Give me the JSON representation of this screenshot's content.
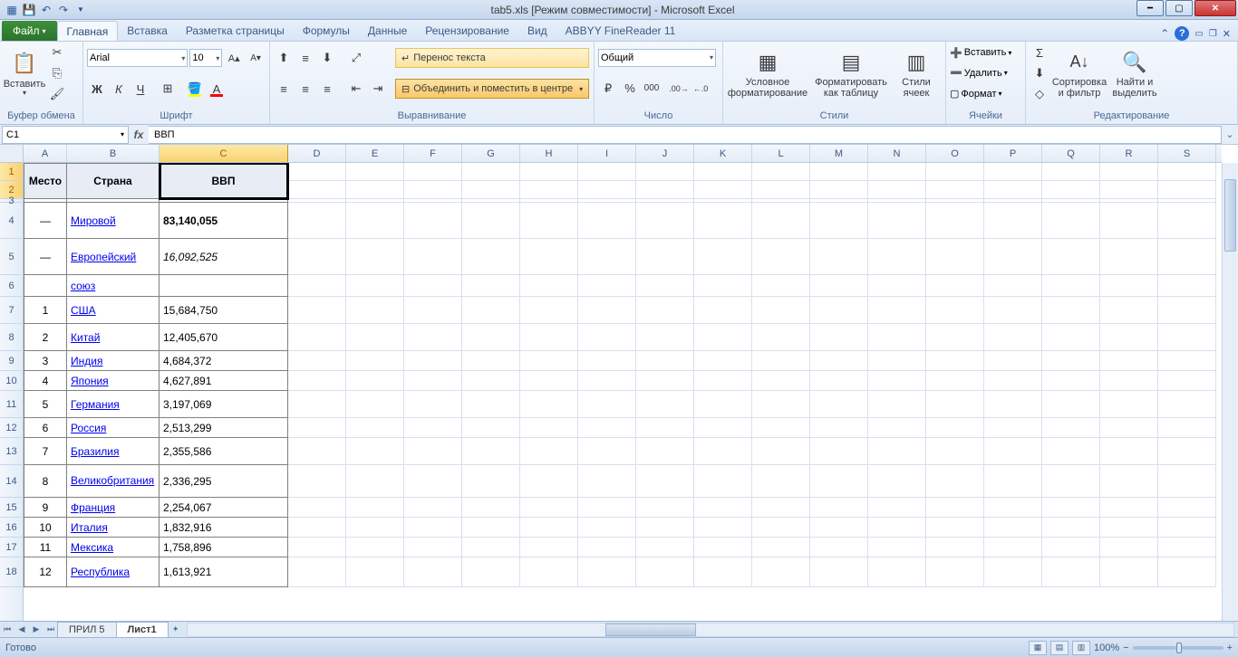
{
  "title": "tab5.xls  [Режим совместимости]  -  Microsoft Excel",
  "file_tab": "Файл",
  "tabs": [
    "Главная",
    "Вставка",
    "Разметка страницы",
    "Формулы",
    "Данные",
    "Рецензирование",
    "Вид",
    "ABBYY FineReader 11"
  ],
  "active_tab": 0,
  "ribbon": {
    "clipboard": {
      "label": "Буфер обмена",
      "paste": "Вставить"
    },
    "font": {
      "label": "Шрифт",
      "name": "Arial",
      "size": "10"
    },
    "alignment": {
      "label": "Выравнивание",
      "wrap": "Перенос текста",
      "merge": "Объединить и поместить в центре"
    },
    "number": {
      "label": "Число",
      "format": "Общий"
    },
    "styles": {
      "label": "Стили",
      "cond": "Условное форматирование",
      "table": "Форматировать как таблицу",
      "cell": "Стили ячеек"
    },
    "cells": {
      "label": "Ячейки",
      "insert": "Вставить",
      "delete": "Удалить",
      "format": "Формат"
    },
    "editing": {
      "label": "Редактирование",
      "sort": "Сортировка и фильтр",
      "find": "Найти и выделить"
    }
  },
  "namebox": "C1",
  "formula": "ВВП",
  "columns": [
    {
      "letter": "A",
      "width": 48
    },
    {
      "letter": "B",
      "width": 102
    },
    {
      "letter": "C",
      "width": 142
    },
    {
      "letter": "D",
      "width": 64
    },
    {
      "letter": "E",
      "width": 64
    },
    {
      "letter": "F",
      "width": 64
    },
    {
      "letter": "G",
      "width": 64
    },
    {
      "letter": "H",
      "width": 64
    },
    {
      "letter": "I",
      "width": 64
    },
    {
      "letter": "J",
      "width": 64
    },
    {
      "letter": "K",
      "width": 64
    },
    {
      "letter": "L",
      "width": 64
    },
    {
      "letter": "M",
      "width": 64
    },
    {
      "letter": "N",
      "width": 64
    },
    {
      "letter": "O",
      "width": 64
    },
    {
      "letter": "P",
      "width": 64
    },
    {
      "letter": "Q",
      "width": 64
    },
    {
      "letter": "R",
      "width": 64
    },
    {
      "letter": "S",
      "width": 64
    }
  ],
  "selected_col_index": 2,
  "rows_vis": [
    {
      "num": 1,
      "h": 20,
      "header": true,
      "merge": true
    },
    {
      "num": 2,
      "h": 20,
      "header": true,
      "merge": true
    },
    {
      "num": 3,
      "h": 4,
      "spacer": true
    },
    {
      "num": 4,
      "h": 40,
      "place": "—",
      "country": "Мировой",
      "gdp": "83,140,055",
      "bold": true
    },
    {
      "num": 5,
      "h": 40,
      "place": "—",
      "country": "Европейский",
      "gdp": "16,092,525",
      "italic": true
    },
    {
      "num": 6,
      "h": 24,
      "country": "союз"
    },
    {
      "num": 7,
      "h": 30,
      "place": "1",
      "country": "США",
      "gdp": "15,684,750"
    },
    {
      "num": 8,
      "h": 30,
      "place": "2",
      "country": "Китай",
      "gdp": "12,405,670"
    },
    {
      "num": 9,
      "h": 22,
      "place": "3",
      "country": "Индия",
      "gdp": "4,684,372"
    },
    {
      "num": 10,
      "h": 22,
      "place": "4",
      "country": "Япония",
      "gdp": "4,627,891"
    },
    {
      "num": 11,
      "h": 30,
      "place": "5",
      "country": "Германия",
      "gdp": "3,197,069"
    },
    {
      "num": 12,
      "h": 22,
      "place": "6",
      "country": "Россия",
      "gdp": "2,513,299"
    },
    {
      "num": 13,
      "h": 30,
      "place": "7",
      "country": "Бразилия",
      "gdp": "2,355,586"
    },
    {
      "num": 14,
      "h": 36,
      "place": "8",
      "country": "Великобритания",
      "gdp": "2,336,295",
      "wrap": true
    },
    {
      "num": 15,
      "h": 22,
      "place": "9",
      "country": "Франция",
      "gdp": "2,254,067"
    },
    {
      "num": 16,
      "h": 22,
      "place": "10",
      "country": "Италия",
      "gdp": "1,832,916"
    },
    {
      "num": 17,
      "h": 22,
      "place": "11",
      "country": "Мексика",
      "gdp": "1,758,896"
    },
    {
      "num": 18,
      "h": 33,
      "place": "12",
      "country": "Республика",
      "gdp": "1,613,921"
    }
  ],
  "table_headers": {
    "place": "Место",
    "country": "Страна",
    "gdp": "ВВП"
  },
  "sheet_tabs": [
    "ПРИЛ 5",
    "Лист1"
  ],
  "active_sheet": 1,
  "status": "Готово",
  "zoom": "100%"
}
